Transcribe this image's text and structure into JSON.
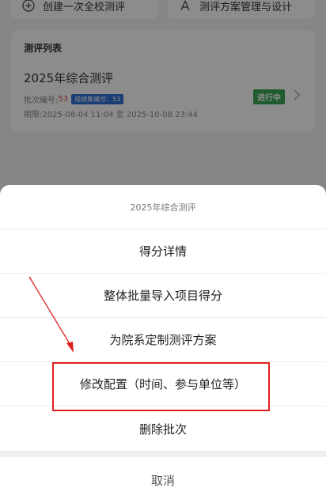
{
  "top_actions": {
    "create_label": "创建一次全校测评",
    "manage_label": "测评方案管理与设计"
  },
  "eval_list": {
    "title": "测评列表",
    "item": {
      "title": "2025年综合测评",
      "batch_label": "批次编号:",
      "batch_no": "53",
      "score_badge": "成绩集编号：53",
      "period": "期限:2025-08-04 11:04 至 2025-10-08 23:44",
      "status": "进行中"
    }
  },
  "sheet": {
    "title": "2025年综合测评",
    "items": [
      "得分详情",
      "整体批量导入项目得分",
      "为院系定制测评方案",
      "修改配置（时间、参与单位等）",
      "删除批次"
    ],
    "cancel": "取消"
  },
  "colors": {
    "status_green": "#3aa756",
    "badge_blue": "#2f6fd6",
    "annotation_red": "#e02020"
  }
}
